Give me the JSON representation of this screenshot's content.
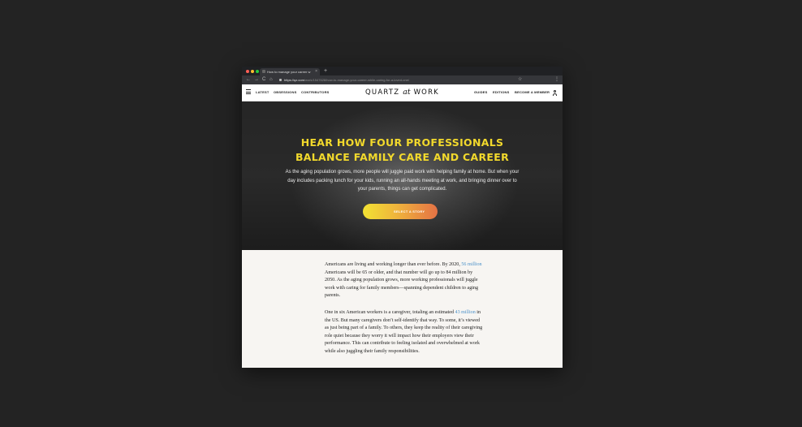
{
  "browser": {
    "tab_title": "How to manage your career w",
    "tab_close": "×",
    "new_tab": "+",
    "back": "←",
    "forward": "→",
    "reload": "C",
    "home": "⌂",
    "url_host": "https://qz.com",
    "url_path": "/work/1547628/how-to-manage-your-career-while-caring-for-a-loved-one/",
    "bookmark_star": "☆",
    "menu": "⋮"
  },
  "site_nav": {
    "links_left": [
      "LATEST",
      "OBSESSIONS",
      "CONTRIBUTORS"
    ],
    "logo_left": "QUARTZ",
    "logo_at": "at",
    "logo_right": "WORK",
    "links_right": [
      "GUIDES",
      "EDITIONS",
      "BECOME A MEMBER"
    ]
  },
  "hero": {
    "title_line1": "HEAR HOW FOUR PROFESSIONALS",
    "title_line2": "BALANCE FAMILY CARE AND CAREER",
    "subtitle": "As the aging population grows, more people will juggle paid work with helping family at home. But when your day includes packing lunch for your kids, running an all-hands meeting at work, and bringing dinner over to your parents, things can get complicated.",
    "cta_label": "SELECT A STORY"
  },
  "article": {
    "p1_a": "Americans are living and working longer than ever before. By 2020, ",
    "p1_link": "56 million",
    "p1_b": " Americans will be 65 or older, and that number will go up to 84 million by 2050. As the aging population grows, more working professionals will juggle work with caring for family members—spanning dependent children to aging parents.",
    "p2_a": "One in six American workers is a caregiver, totaling an estimated ",
    "p2_link": "43 million",
    "p2_b": " in the US. But many caregivers don’t self-identify that way. To some, it’s viewed as just being part of a family. To others, they keep the reality of their caregiving role quiet because they worry it will impact how their employers view their performance. This can contribute to feeling isolated and overwhelmed at work while also juggling their family responsibilities."
  },
  "colors": {
    "hero_title": "#f2d92c",
    "link": "#4a90c8",
    "cta_gradient_start": "#f2e233",
    "cta_gradient_end": "#e57245"
  }
}
